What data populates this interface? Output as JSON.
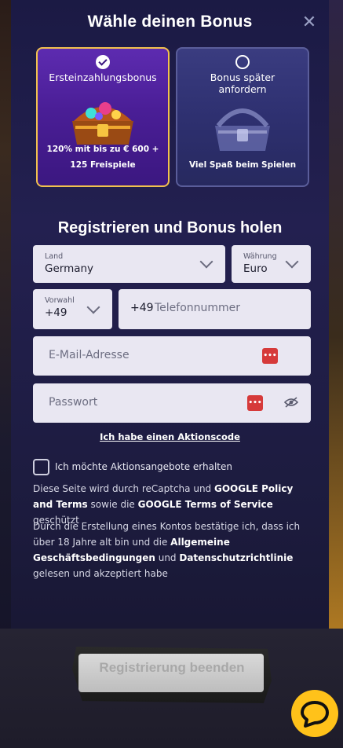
{
  "modal": {
    "title": "Wähle deinen Bonus",
    "close_icon": "close-icon"
  },
  "bonus_cards": [
    {
      "label": "Ersteinzahlungsbonus",
      "description_line1": "120% mit bis zu € 600 +",
      "description_line2": "125 Freispiele",
      "selected": true
    },
    {
      "label_line1": "Bonus später",
      "label_line2": "anfordern",
      "description": "Viel Spaß beim Spielen",
      "selected": false
    }
  ],
  "section_title": "Registrieren und Bonus holen",
  "form": {
    "country": {
      "label": "Land",
      "value": "Germany"
    },
    "currency": {
      "label": "Währung",
      "value": "Euro"
    },
    "dial_code": {
      "label": "Vorwahl",
      "value": "+49"
    },
    "phone": {
      "prefix": "+49",
      "placeholder": "Telefonnummer"
    },
    "email": {
      "placeholder": "E-Mail-Adresse"
    },
    "password": {
      "placeholder": "Passwort"
    },
    "promo_link": "Ich habe einen Aktionscode"
  },
  "marketing_opt_in": {
    "label": "Ich möchte Aktionsangebote erhalten",
    "checked": false
  },
  "legal": {
    "recaptcha_1": "Diese Seite wird durch reCaptcha und ",
    "recaptcha_b1": "GOOGLE Policy and Terms",
    "recaptcha_2": " sowie die ",
    "recaptcha_b2": "GOOGLE Terms of Service",
    "recaptcha_3": " geschützt",
    "terms_1": "Durch die Erstellung eines Kontos bestätige ich, dass ich über 18 Jahre alt bin und die ",
    "terms_b1": "Allgemeine Geschäftsbedingungen",
    "terms_2": " und ",
    "terms_b2": "Datenschutzrichtlinie",
    "terms_3": " gelesen und akzeptiert habe"
  },
  "submit_label": "Registrierung beenden",
  "colors": {
    "accent": "#f2c14e",
    "chat": "#ffc21a",
    "error_icon": "#d63a3a"
  }
}
